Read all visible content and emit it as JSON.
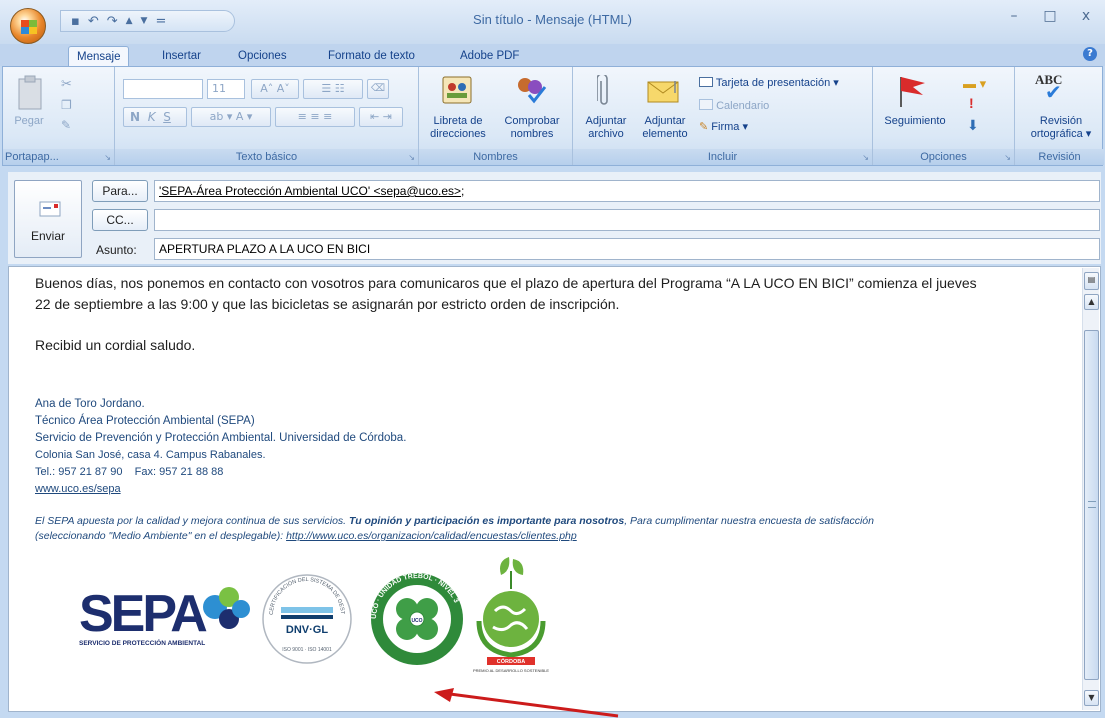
{
  "window": {
    "title": "Sin título - Mensaje (HTML)",
    "min_glyph": "–",
    "max_glyph": "□",
    "close_glyph": "x"
  },
  "quick_access": {
    "save_glyph": "▪",
    "undo_glyph": "↶",
    "redo_glyph": "↷",
    "up_glyph": "▲",
    "down_glyph": "▼",
    "more_glyph": "="
  },
  "tabs": [
    "Mensaje",
    "Insertar",
    "Opciones",
    "Formato de texto",
    "Adobe PDF"
  ],
  "ribbon": {
    "clipboard": {
      "paste_label": "Pegar",
      "group_label": "Portapap..."
    },
    "basic_text": {
      "font_size": "11",
      "bold": "N",
      "italic": "K",
      "underline": "S",
      "group_label": "Texto básico"
    },
    "names": {
      "address_book": "Libreta de direcciones",
      "check_names": "Comprobar nombres",
      "group_label": "Nombres"
    },
    "include": {
      "attach_file": "Adjuntar archivo",
      "attach_item": "Adjuntar elemento",
      "business_card": "Tarjeta de presentación",
      "calendar": "Calendario",
      "signature": "Firma",
      "group_label": "Incluir"
    },
    "options": {
      "follow_up": "Seguimiento",
      "group_label": "Opciones"
    },
    "proofing": {
      "spelling_icon": "ABC",
      "spelling": "Revisión ortográfica",
      "group_label": "Revisión"
    }
  },
  "header": {
    "send_label": "Enviar",
    "to_button": "Para...",
    "to_value_name": "'SEPA-Área Protección Ambiental UCO' <sepa@uco.es>",
    "to_value_sep": ";",
    "cc_button": "CC...",
    "cc_value": "",
    "subject_label": "Asunto:",
    "subject_value": "APERTURA PLAZO A LA UCO EN BICI"
  },
  "body": {
    "paragraph1_line1": "Buenos días, nos ponemos en contacto con vosotros para comunicaros que el plazo de apertura del Programa “A LA UCO EN BICI” comienza el jueves",
    "paragraph1_line2": "22 de septiembre a las 9:00 y que las bicicletas se asignarán por estricto orden de inscripción.",
    "greeting": "Recibid un cordial saludo.",
    "signature": {
      "name": "Ana de Toro Jordano.",
      "position": "Técnico Área Protección Ambiental (SEPA)",
      "service": "Servicio de Prevención y Protección Ambiental. Universidad de Córdoba.",
      "address": "Colonia San José, casa 4. Campus Rabanales.",
      "phones": "Tel.: 957 21 87 90    Fax: 957 21 88 88",
      "website": "www.uco.es/sepa"
    },
    "survey_line1_a": "El SEPA apuesta por la calidad y mejora continua de sus servicios. ",
    "survey_line1_bold": "Tu opinión y participación es importante para nosotros",
    "survey_line1_b": ", Para cumplimentar nuestra encuesta de satisfacción",
    "survey_line2_a": "(seleccionando \"Medio Ambiente\" en el desplegable): ",
    "survey_link": "http://www.uco.es/organizacion/calidad/encuestas/clientes.php",
    "logos": {
      "sepa_name": "SEPA",
      "sepa_subtitle": "SERVICIO DE PROTECCIÓN AMBIENTAL",
      "dnv_name": "DNV·GL",
      "dnv_ring": "CERTIFICACIÓN DEL SISTEMA DE GESTIÓN",
      "dnv_iso": "ISO 9001 · ISO 14001",
      "trebol_ring": "UCO · UNIDAD TRÉBOL · NIVEL 3",
      "trebol_center": "UCO",
      "cordoba_title": "CÓRDOBA",
      "cordoba_caption": "PREMIO AL DESARROLLO SOSTENIBLE"
    }
  },
  "colors": {
    "accent_red": "#cc1b1b",
    "link_blue": "#1f497d",
    "ribbon_bg": "#dbe8f6",
    "sepa_navy": "#1d2e6e",
    "trebol_green": "#2f8a3a"
  }
}
